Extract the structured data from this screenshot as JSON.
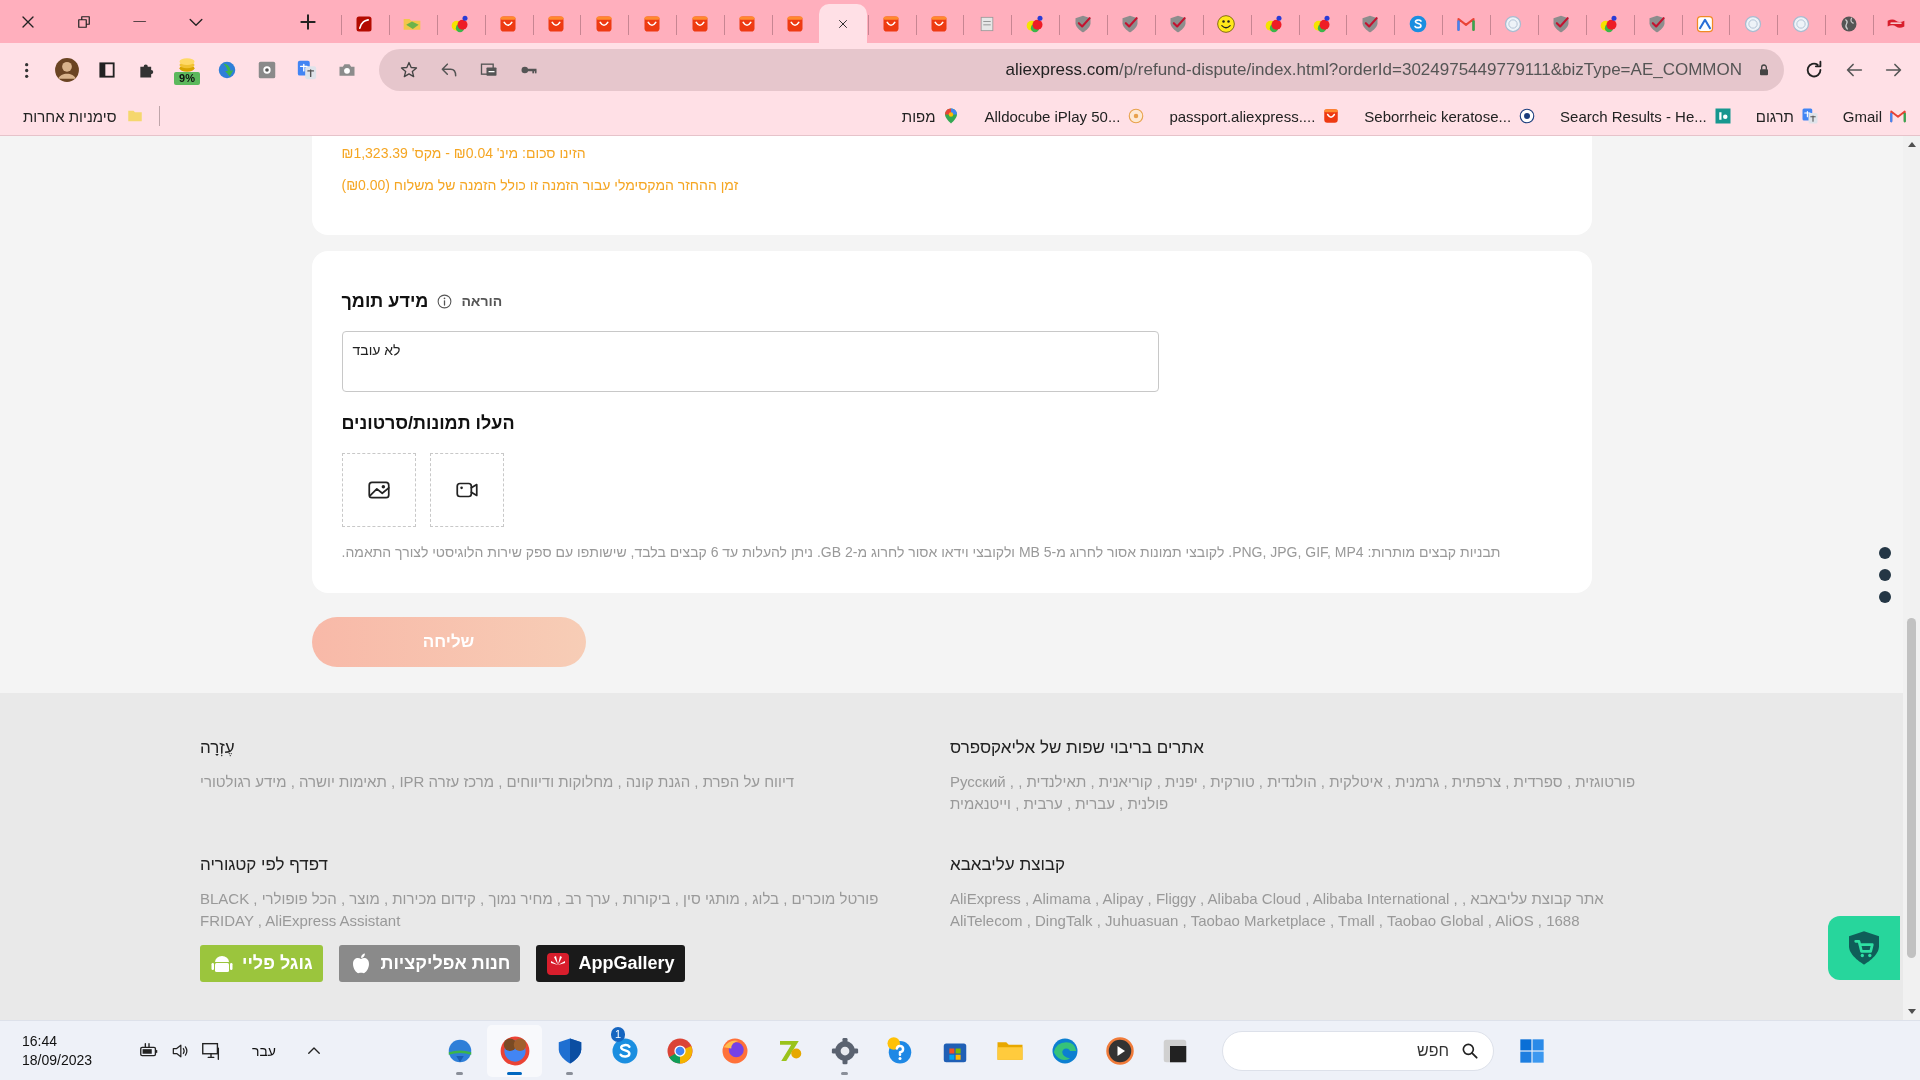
{
  "browser": {
    "tabs": [
      {
        "kind": "pdf",
        "selected": false
      },
      {
        "kind": "folder",
        "selected": false
      },
      {
        "kind": "sp",
        "selected": false
      },
      {
        "kind": "ali",
        "selected": false
      },
      {
        "kind": "ali",
        "selected": false
      },
      {
        "kind": "ali",
        "selected": false
      },
      {
        "kind": "ali",
        "selected": false
      },
      {
        "kind": "ali",
        "selected": false
      },
      {
        "kind": "ali",
        "selected": false
      },
      {
        "kind": "ali",
        "selected": false
      },
      {
        "selected": true
      },
      {
        "kind": "ali",
        "selected": false
      },
      {
        "kind": "ali",
        "selected": false
      },
      {
        "kind": "stamp",
        "selected": false
      },
      {
        "kind": "sp",
        "selected": false
      },
      {
        "kind": "shield",
        "selected": false
      },
      {
        "kind": "shield",
        "selected": false
      },
      {
        "kind": "shield",
        "selected": false
      },
      {
        "kind": "smiley",
        "selected": false
      },
      {
        "kind": "sp",
        "selected": false
      },
      {
        "kind": "sp",
        "selected": false
      },
      {
        "kind": "shield",
        "selected": false
      },
      {
        "kind": "skype",
        "selected": false
      },
      {
        "kind": "gmail",
        "selected": false
      },
      {
        "kind": "seal",
        "selected": false
      },
      {
        "kind": "shield",
        "selected": false
      },
      {
        "kind": "sp",
        "selected": false
      },
      {
        "kind": "shield",
        "selected": false
      },
      {
        "kind": "amt",
        "selected": false
      },
      {
        "kind": "seal",
        "selected": false
      },
      {
        "kind": "seal",
        "selected": false
      },
      {
        "kind": "globe",
        "selected": false
      },
      {
        "kind": "flag",
        "selected": false
      }
    ],
    "extension_badge": "9%",
    "url": {
      "host": "aliexpress.com",
      "path": "/p/refund-dispute/index.html?orderId=3024975449779111&bizType=AE_COMMON"
    },
    "other_bookmarks": "סימניות אחרות",
    "bookmarks": [
      {
        "label": "Gmail",
        "kind": "gmail"
      },
      {
        "label": "תרגום",
        "kind": "translate"
      },
      {
        "label": "Search Results - He...",
        "kind": "hc"
      },
      {
        "label": "Seborrheic keratose...",
        "kind": "aad"
      },
      {
        "label": "passport.aliexpress....",
        "kind": "ali"
      },
      {
        "label": "Alldocube iPlay 50...",
        "kind": "rp"
      },
      {
        "label": "מפות",
        "kind": "maps"
      }
    ]
  },
  "refund_card": {
    "amount_hint": "הזינו סכום: מינ' ₪0.04 - מקס' ₪1,323.39",
    "refund_note": "זמן ההחזר המקסימלי עבור הזמנה זו כולל הזמנה של משלוח (₪0.00)"
  },
  "evidence": {
    "title": "מידע תומך",
    "instruction": "הוראה",
    "description": "לא עובד",
    "upload_title": "העלו תמונות/סרטונים",
    "upload_slots": [
      {
        "kind": "image"
      },
      {
        "kind": "video"
      }
    ],
    "upload_hint": "תבניות קבצים מותרות: PNG, JPG, GIF, MP4. לקובצי תמונות אסור לחרוג מ-5 MB ולקובצי וידאו אסור לחרוג מ-2 GB. ניתן להעלות עד 6 קבצים בלבד, שישותפו עם ספק שירות הלוגיסטי לצורך התאמה."
  },
  "submit": {
    "label": "שליחה",
    "disabled": true
  },
  "footer": {
    "sections": [
      {
        "title": "אתרים בריבוי שפות של אליאקספרס",
        "links": "פורטוגזית , ספרדית , צרפתית , גרמנית , איטלקית , הולנדית , טורקית , יפנית , קוריאנית , תאילנדית , , Русский פולנית , עברית , ערבית , וייטנאמית"
      },
      {
        "title": "עֶזְרָה",
        "links": "דיווח על הפרת , הגנת קונה , מחלוקות ודיווחים , מרכז עזרה IPR , תאימות יושרה , מידע רגולטורי"
      },
      {
        "title": "קבוצת עליבאבא",
        "links": "אתר קבוצת עליבאבא , AliExpress , Alimama , Alipay , Fliggy , Alibaba Cloud , Alibaba International , AliTelecom , DingTalk , Juhuasuan , Taobao Marketplace , Tmall , Taobao Global , AliOS , 1688"
      },
      {
        "title": "דפדף לפי קטגוריה",
        "links": "פורטל מוכרים , בלוג , מותגי סין , ביקורות , ערך רב , מחיר נמוך , קידום מכירות , מוצר , הכל פופולרי , BLACK FRIDAY , AliExpress Assistant",
        "app_buttons": [
          {
            "kind": "app_gallery",
            "label": "AppGallery"
          },
          {
            "kind": "app_store",
            "label": "חנות אפליקציות"
          },
          {
            "kind": "google_play",
            "label": "גוגל פליי"
          }
        ]
      }
    ]
  },
  "taskbar": {
    "time": "16:44",
    "date": "18/09/2023",
    "language": "עבר",
    "search": {
      "placeholder": "חפש"
    },
    "apps": [
      {
        "kind": "idm",
        "running": true,
        "selected": false
      },
      {
        "kind": "profile",
        "running": true,
        "selected": true
      },
      {
        "kind": "defender",
        "running": true,
        "selected": false
      },
      {
        "kind": "skype",
        "running": false,
        "selected": false,
        "badge": "1"
      },
      {
        "kind": "chrome",
        "running": false,
        "selected": false
      },
      {
        "kind": "firefox",
        "running": false,
        "selected": false
      },
      {
        "kind": "zip",
        "running": false,
        "selected": false
      },
      {
        "kind": "settings",
        "running": true,
        "selected": false
      },
      {
        "kind": "help",
        "running": false,
        "selected": false
      },
      {
        "kind": "store",
        "running": false,
        "selected": false
      },
      {
        "kind": "explorer",
        "running": false,
        "selected": false
      },
      {
        "kind": "edge",
        "running": false,
        "selected": false
      },
      {
        "kind": "media",
        "running": false,
        "selected": false
      },
      {
        "kind": "window",
        "running": false,
        "selected": false
      }
    ]
  }
}
